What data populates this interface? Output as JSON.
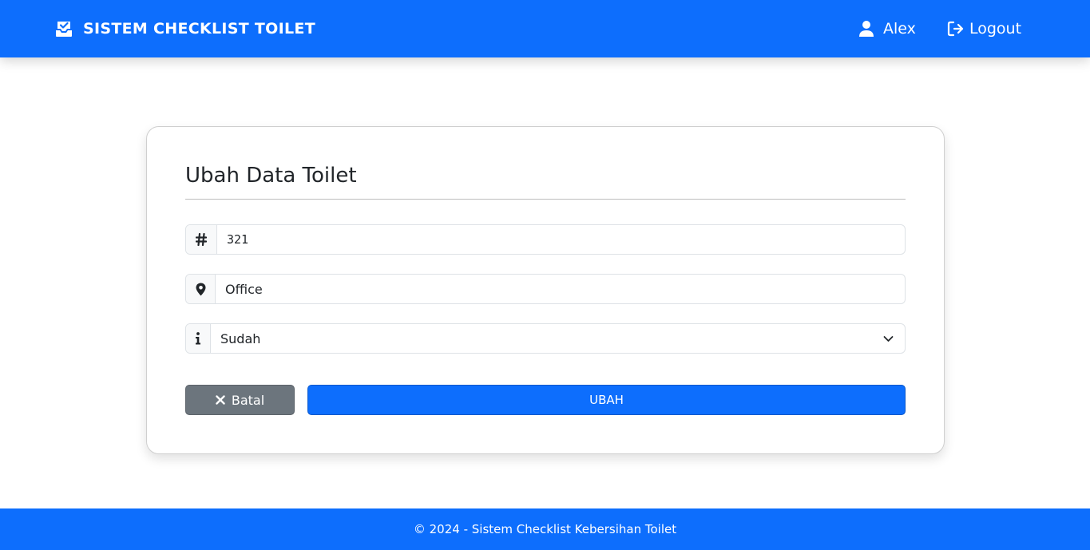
{
  "header": {
    "brand_icon": "inbox-check-icon",
    "brand_title": "SISTEM CHECKLIST TOILET",
    "user_icon": "user-icon",
    "user_name": "Alex",
    "logout_icon": "logout-icon",
    "logout_label": "Logout"
  },
  "form": {
    "title": "Ubah Data Toilet",
    "id_field": {
      "icon": "hash-icon",
      "value": "321"
    },
    "location_field": {
      "icon": "map-pin-icon",
      "value": "Office"
    },
    "status_field": {
      "icon": "info-icon",
      "selected": "Sudah"
    },
    "cancel_icon": "close-icon",
    "cancel_label": "Batal",
    "submit_label": "UBAH"
  },
  "footer": {
    "text": "© 2024 - Sistem Checklist Kebersihan Toilet"
  },
  "colors": {
    "primary": "#0d6efd",
    "secondary": "#6c757d"
  }
}
